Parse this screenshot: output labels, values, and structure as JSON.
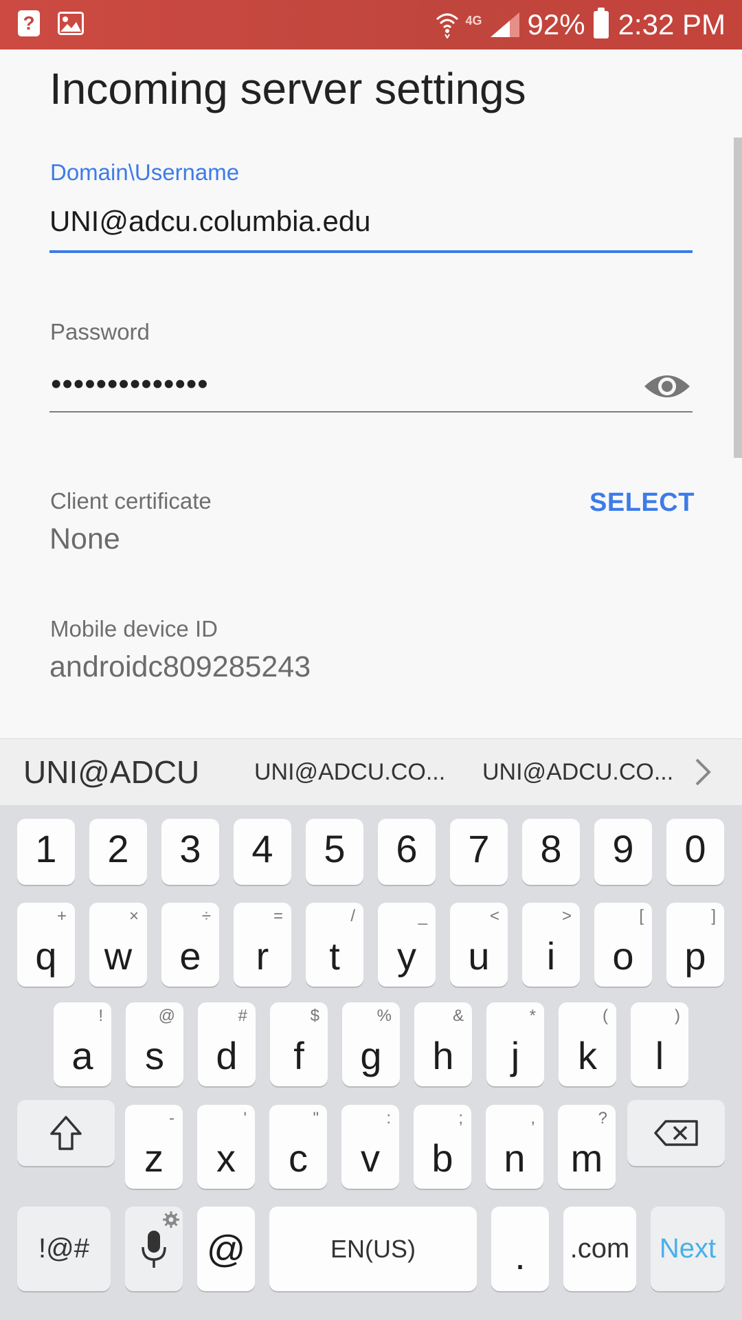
{
  "status_bar": {
    "battery": "92%",
    "time": "2:32 PM",
    "network": "4G"
  },
  "page": {
    "title": "Incoming server settings"
  },
  "form": {
    "username": {
      "label": "Domain\\Username",
      "value": "UNI@adcu.columbia.edu"
    },
    "password": {
      "label": "Password",
      "value": "••••••••••••••"
    },
    "client_certificate": {
      "label": "Client certificate",
      "value": "None",
      "action": "SELECT"
    },
    "mobile_device_id": {
      "label": "Mobile device ID",
      "value": "androidc809285243"
    }
  },
  "suggestions": [
    "UNI@ADCU",
    "UNI@ADCU.CO...",
    "UNI@ADCU.CO..."
  ],
  "keyboard": {
    "numbers": [
      "1",
      "2",
      "3",
      "4",
      "5",
      "6",
      "7",
      "8",
      "9",
      "0"
    ],
    "row1": [
      [
        "q",
        "+"
      ],
      [
        "w",
        "×"
      ],
      [
        "e",
        "÷"
      ],
      [
        "r",
        "="
      ],
      [
        "t",
        "/"
      ],
      [
        "y",
        "_"
      ],
      [
        "u",
        "<"
      ],
      [
        "i",
        ">"
      ],
      [
        "o",
        "["
      ],
      [
        "p",
        "]"
      ]
    ],
    "row2": [
      [
        "a",
        "!"
      ],
      [
        "s",
        "@"
      ],
      [
        "d",
        "#"
      ],
      [
        "f",
        "$"
      ],
      [
        "g",
        "%"
      ],
      [
        "h",
        "&"
      ],
      [
        "j",
        "*"
      ],
      [
        "k",
        "("
      ],
      [
        "l",
        ")"
      ]
    ],
    "row3": [
      [
        "z",
        "-"
      ],
      [
        "x",
        "'"
      ],
      [
        "c",
        "\""
      ],
      [
        "v",
        ":"
      ],
      [
        "b",
        ";"
      ],
      [
        "n",
        ","
      ],
      [
        "m",
        "?"
      ]
    ],
    "bottom": {
      "symbols": "!@#",
      "at": "@",
      "space": "EN(US)",
      "period": ".",
      "dotcom": ".com",
      "next": "Next"
    }
  },
  "colors": {
    "accent": "#3d7be8",
    "status_bar": "#c9453d",
    "next_key": "#47b0e8"
  }
}
